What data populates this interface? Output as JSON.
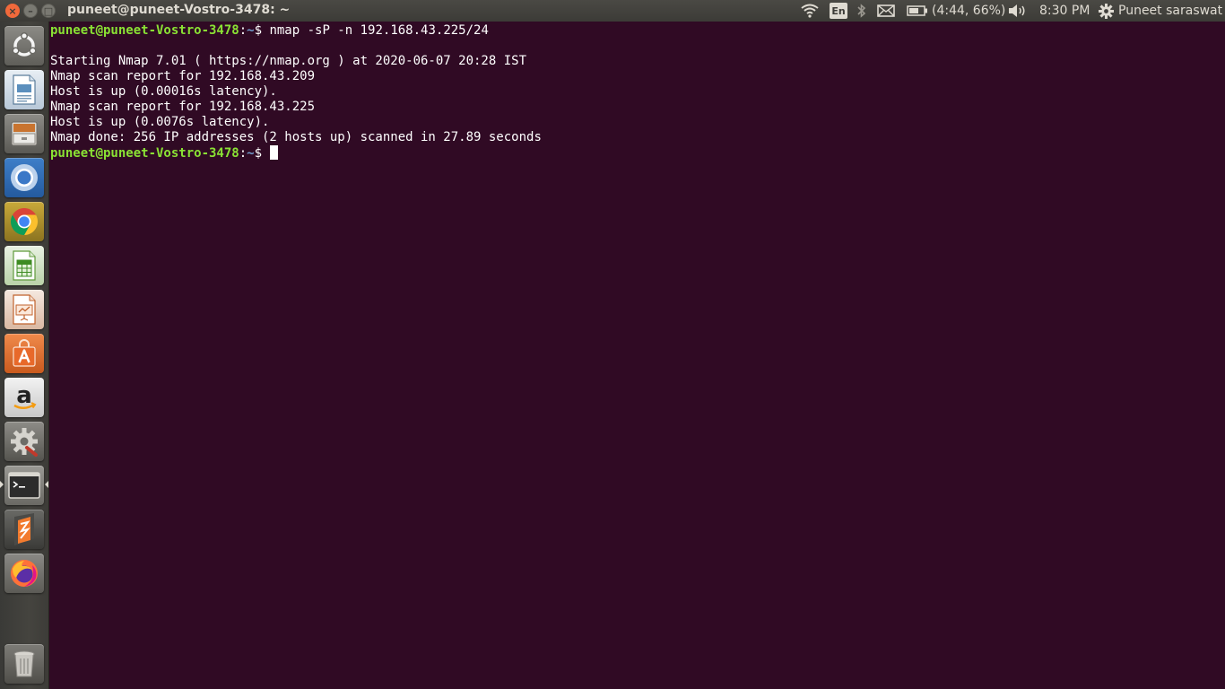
{
  "topbar": {
    "window_title": "puneet@puneet-Vostro-3478: ~",
    "window_buttons": {
      "close": "×",
      "minimize": "–",
      "maximize": "□"
    },
    "keyboard_layout": "En",
    "battery": "(4:44, 66%)",
    "clock": "8:30 PM",
    "user_name": "Puneet saraswat",
    "icons": [
      "wifi-icon",
      "keyboard-layout-indicator",
      "bluetooth-icon",
      "mail-icon",
      "battery-icon",
      "volume-icon",
      "gear-icon"
    ]
  },
  "launcher": {
    "items": [
      {
        "name": "dash-home",
        "icon": "ubuntu-logo-icon"
      },
      {
        "name": "libreoffice-writer",
        "icon": "document-icon"
      },
      {
        "name": "files",
        "icon": "file-cabinet-icon"
      },
      {
        "name": "chromium",
        "icon": "chromium-icon"
      },
      {
        "name": "google-chrome",
        "icon": "chrome-icon"
      },
      {
        "name": "libreoffice-calc",
        "icon": "spreadsheet-icon"
      },
      {
        "name": "libreoffice-impress",
        "icon": "presentation-icon"
      },
      {
        "name": "ubuntu-software",
        "icon": "shopping-bag-icon"
      },
      {
        "name": "amazon",
        "icon": "amazon-icon"
      },
      {
        "name": "system-settings",
        "icon": "settings-wrench-icon"
      },
      {
        "name": "terminal",
        "icon": "terminal-icon",
        "active": true
      },
      {
        "name": "sublime-text",
        "icon": "sublime-icon"
      },
      {
        "name": "firefox",
        "icon": "firefox-icon"
      },
      {
        "name": "trash",
        "icon": "trash-icon"
      }
    ]
  },
  "terminal": {
    "prompt_user": "puneet@puneet-Vostro-3478",
    "prompt_sep": ":",
    "prompt_path": "~",
    "prompt_end": "$ ",
    "command": "nmap -sP -n 192.168.43.225/24",
    "output": [
      "",
      "Starting Nmap 7.01 ( https://nmap.org ) at 2020-06-07 20:28 IST",
      "Nmap scan report for 192.168.43.209",
      "Host is up (0.00016s latency).",
      "Nmap scan report for 192.168.43.225",
      "Host is up (0.0076s latency).",
      "Nmap done: 256 IP addresses (2 hosts up) scanned in 27.89 seconds"
    ]
  }
}
